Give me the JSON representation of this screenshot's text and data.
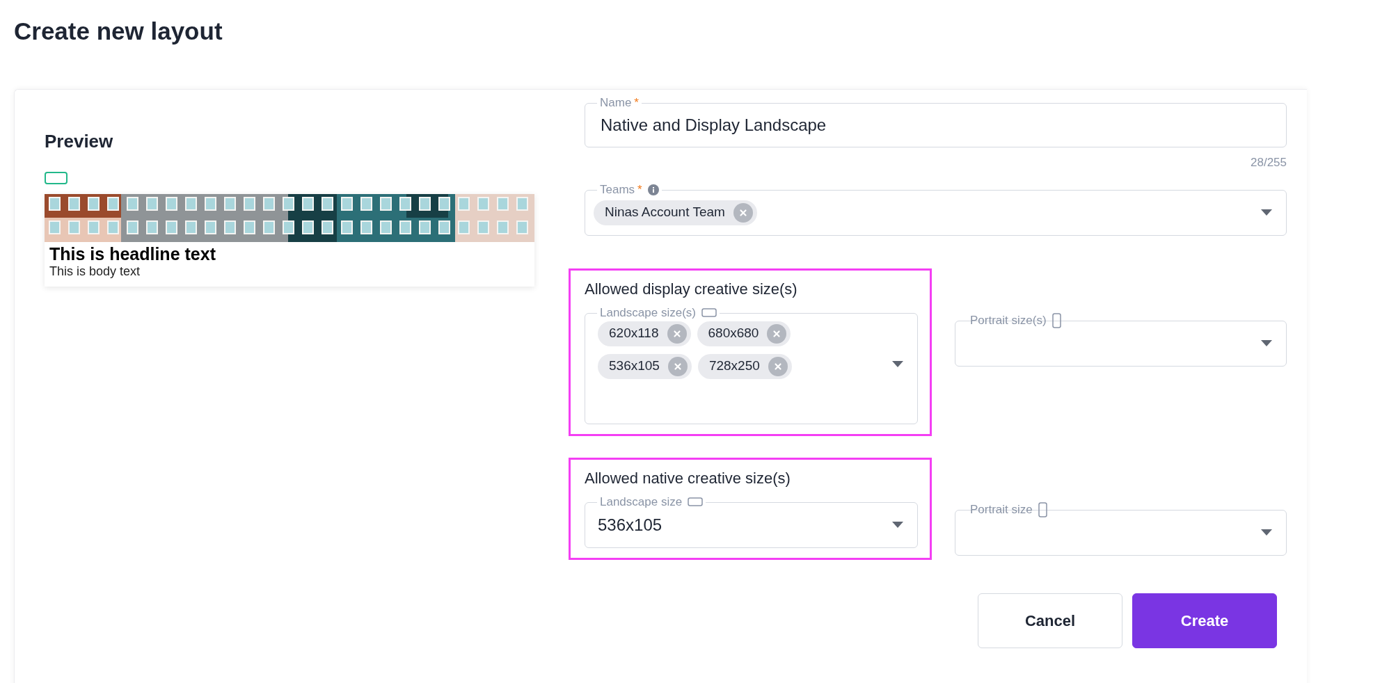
{
  "page_title": "Create new layout",
  "preview": {
    "heading": "Preview",
    "headline": "This is headline text",
    "body": "This is body text"
  },
  "name_field": {
    "label": "Name",
    "required_mark": "*",
    "value": "Native and Display Landscape",
    "counter": "28/255"
  },
  "teams_field": {
    "label": "Teams",
    "required_mark": "*",
    "chips": [
      "Ninas Account Team"
    ]
  },
  "sections": [
    {
      "heading": "Allowed display creative size(s)",
      "fields": [
        {
          "label": "Landscape size(s)",
          "kind": "landscape",
          "chips": [
            "620x118",
            "680x680",
            "536x105",
            "728x250"
          ]
        },
        {
          "label": "Portrait size(s)",
          "kind": "portrait"
        }
      ]
    },
    {
      "heading": "Allowed native creative size(s)",
      "fields": [
        {
          "label": "Landscape size",
          "kind": "landscape",
          "value": "536x105"
        },
        {
          "label": "Portrait size",
          "kind": "portrait"
        }
      ]
    }
  ],
  "buttons": [
    {
      "label": "Cancel",
      "kind": "secondary"
    },
    {
      "label": "Create",
      "kind": "primary"
    }
  ]
}
